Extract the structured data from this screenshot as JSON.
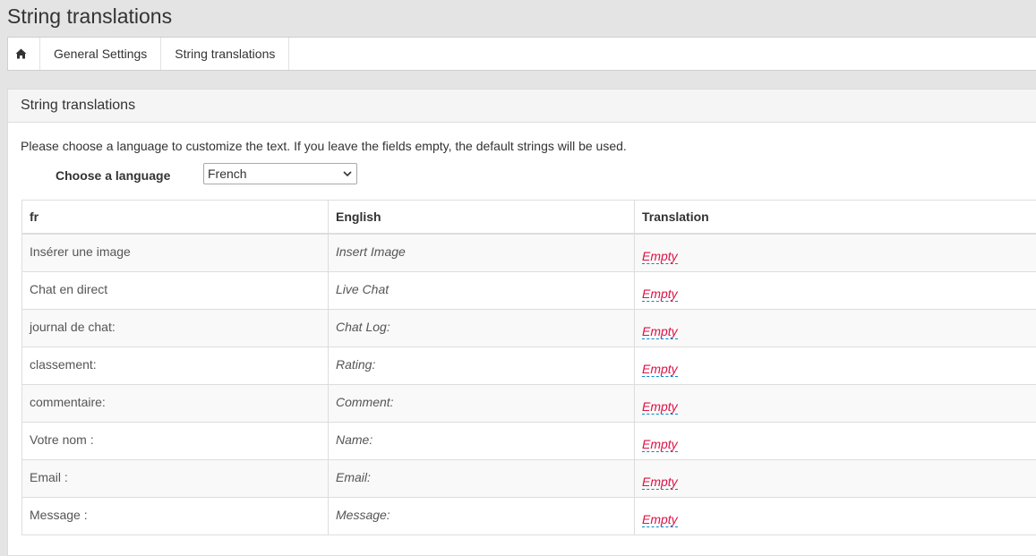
{
  "page": {
    "title": "String translations"
  },
  "breadcrumb": {
    "home_icon": "home-icon",
    "items": [
      "General Settings",
      "String translations"
    ]
  },
  "panel": {
    "title": "String translations",
    "intro": "Please choose a language to customize the text. If you leave the fields empty, the default strings will be used.",
    "language_label": "Choose a language",
    "language_selected": "French"
  },
  "table": {
    "headers": [
      "fr",
      "English",
      "Translation"
    ],
    "rows": [
      {
        "fr": "Insérer une image",
        "en": "Insert Image",
        "translation": "Empty"
      },
      {
        "fr": "Chat en direct",
        "en": "Live Chat",
        "translation": "Empty"
      },
      {
        "fr": "journal de chat:",
        "en": "Chat Log:",
        "translation": "Empty"
      },
      {
        "fr": "classement:",
        "en": "Rating:",
        "translation": "Empty"
      },
      {
        "fr": "commentaire:",
        "en": "Comment:",
        "translation": "Empty"
      },
      {
        "fr": "Votre nom :",
        "en": "Name:",
        "translation": "Empty"
      },
      {
        "fr": "Email :",
        "en": "Email:",
        "translation": "Empty"
      },
      {
        "fr": "Message :",
        "en": "Message:",
        "translation": "Empty"
      }
    ]
  },
  "colors": {
    "empty_text": "#dd1144",
    "empty_underline": "#0088cc",
    "page_background": "#e4e4e4"
  }
}
